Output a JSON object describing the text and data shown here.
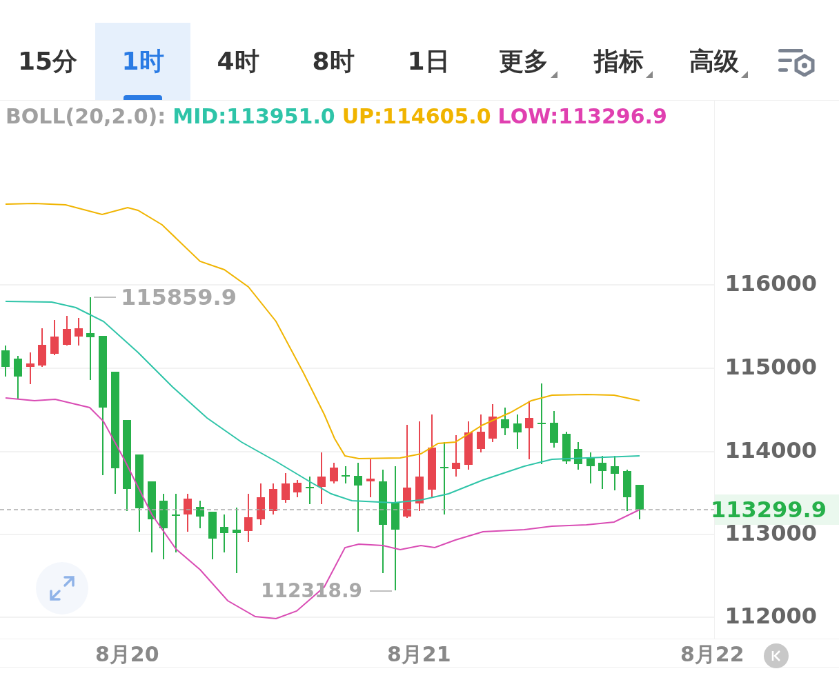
{
  "tabs": [
    {
      "label": "15分",
      "selected": false,
      "kind": "plain"
    },
    {
      "label": "1时",
      "selected": true,
      "kind": "plain"
    },
    {
      "label": "4时",
      "selected": false,
      "kind": "plain"
    },
    {
      "label": "8时",
      "selected": false,
      "kind": "plain"
    },
    {
      "label": "1日",
      "selected": false,
      "kind": "plain"
    },
    {
      "label": "更多",
      "selected": false,
      "kind": "dropdown"
    },
    {
      "label": "指标",
      "selected": false,
      "kind": "dropdown"
    },
    {
      "label": "高级",
      "selected": false,
      "kind": "dropdown"
    }
  ],
  "legend": [
    {
      "text": "BOLL(20,2.0):",
      "color": "#a0a0a0"
    },
    {
      "text": "MID:113951.0",
      "color": "#2ec4a8"
    },
    {
      "text": "UP:114605.0",
      "color": "#f0b400"
    },
    {
      "text": "LOW:113296.9",
      "color": "#e040b0"
    }
  ],
  "y_axis": [
    "116000",
    "115000",
    "114000",
    "113000",
    "112000"
  ],
  "high_marker": "115859.9",
  "low_marker": "112318.9",
  "current_price": "113299.9",
  "dates": [
    "8月20",
    "8月21",
    "8月22"
  ]
}
